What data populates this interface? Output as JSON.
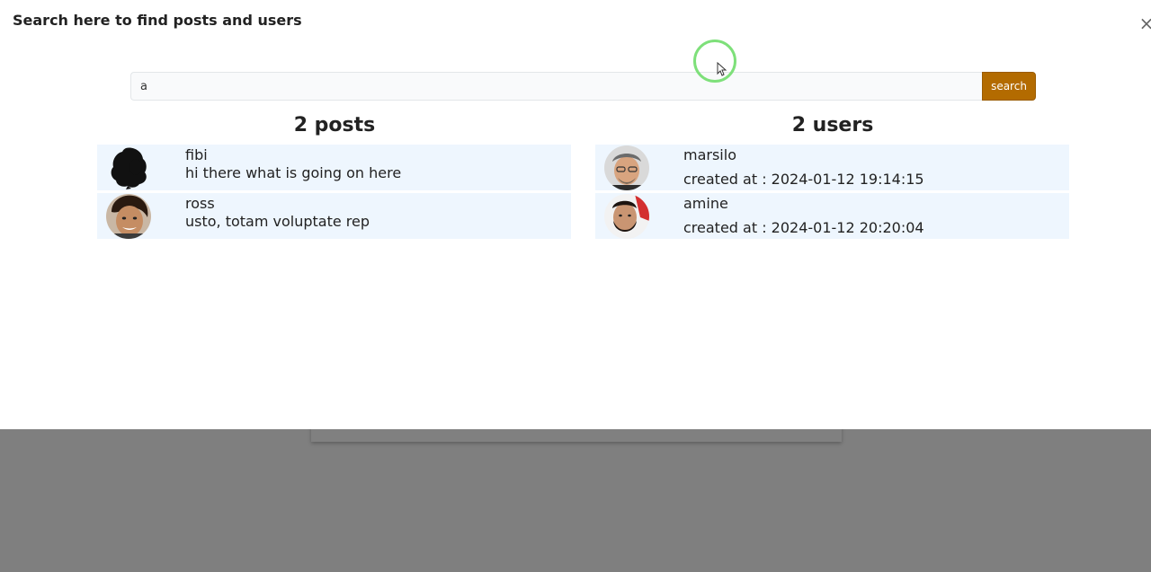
{
  "modal": {
    "title": "Search here to find posts and users",
    "close_label": "×"
  },
  "search": {
    "value": "a",
    "button_label": "search"
  },
  "posts": {
    "heading": "2 posts",
    "items": [
      {
        "name": "fibi",
        "text": "hi there what is going on here",
        "avatar": "silhouette-avatar"
      },
      {
        "name": "ross",
        "text": "usto, totam voluptate rep",
        "avatar": "photo-avatar"
      }
    ]
  },
  "users": {
    "heading": "2 users",
    "items": [
      {
        "name": "marsilo",
        "created": "created at : 2024-01-12 19:14:15",
        "avatar": "photo-avatar"
      },
      {
        "name": "amine",
        "created": "created at : 2024-01-12 20:20:04",
        "avatar": "photo-avatar"
      }
    ]
  },
  "colors": {
    "accent": "#b36b00",
    "item_background": "#eef6fe",
    "overlay": "#7f7f7f",
    "cursor_highlight": "#7ee07a"
  }
}
